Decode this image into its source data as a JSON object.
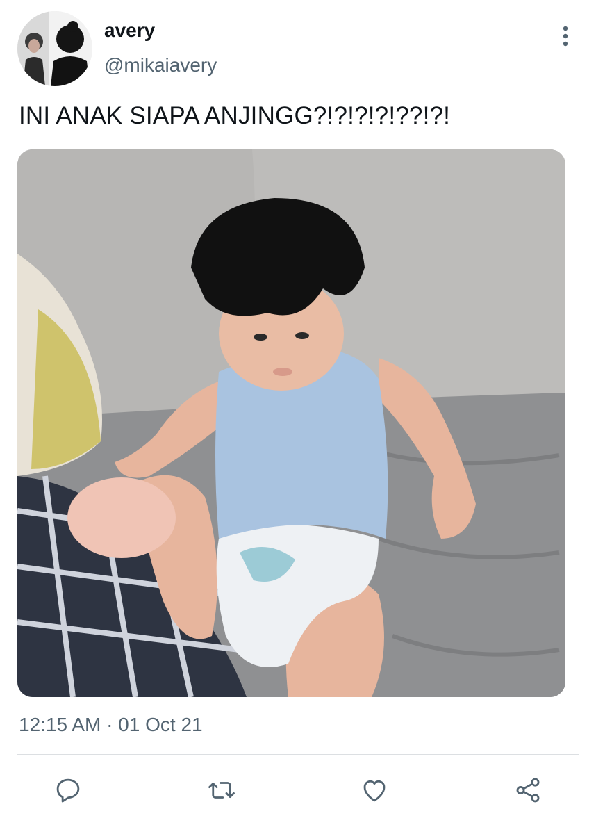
{
  "user": {
    "display_name": "avery",
    "handle": "@mikaiavery",
    "avatar_icon": "profile-photo"
  },
  "tweet": {
    "text": "INI ANAK SIAPA ANJINGG?!?!?!?!??!?!",
    "timestamp": "12:15 AM · 01 Oct 21"
  },
  "media": {
    "type": "photo",
    "icon": "toddler-on-couch-photo"
  },
  "actions": [
    {
      "name": "reply",
      "icon": "reply-icon"
    },
    {
      "name": "retweet",
      "icon": "retweet-icon"
    },
    {
      "name": "like",
      "icon": "heart-icon"
    },
    {
      "name": "share",
      "icon": "share-icon"
    }
  ],
  "more_menu_icon": "more-vertical-icon",
  "colors": {
    "text": "#0f1419",
    "secondary": "#536471",
    "divider": "#dcdfe2",
    "icon": "#536471"
  }
}
